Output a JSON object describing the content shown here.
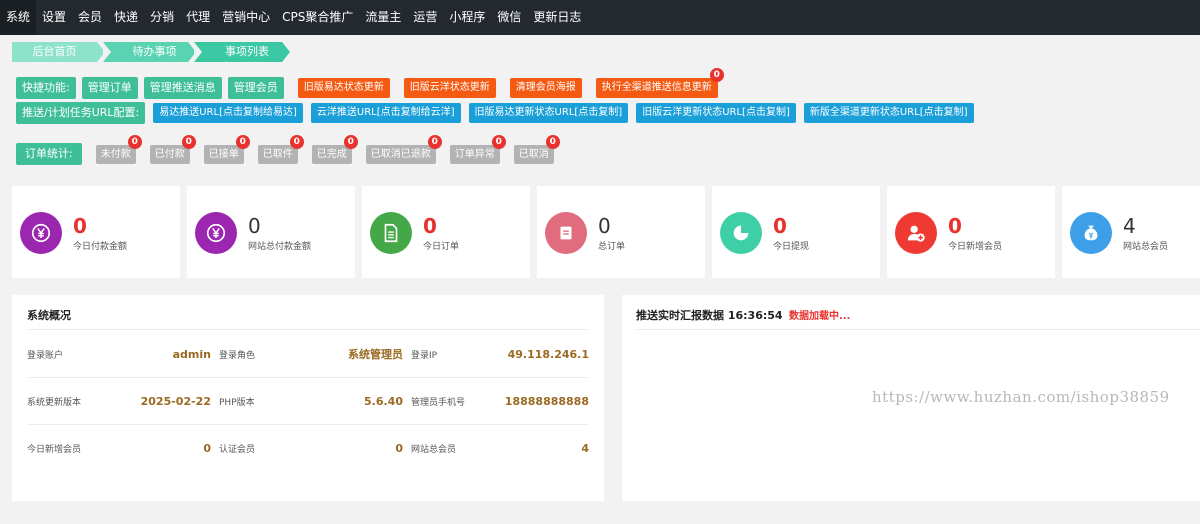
{
  "nav": {
    "items": [
      "系统",
      "设置",
      "会员",
      "快递",
      "分销",
      "代理",
      "营销中心",
      "CPS聚合推广",
      "流量主",
      "运营",
      "小程序",
      "微信",
      "更新日志"
    ]
  },
  "breadcrumb": [
    "后台首页",
    "待办事项",
    "事项列表"
  ],
  "quick": {
    "label": "快捷功能:",
    "green_buttons": [
      "管理订单",
      "管理推送消息",
      "管理会员"
    ],
    "orange_buttons": [
      "旧版易达状态更新",
      "旧版云洋状态更新",
      "清理会员海报",
      "执行全渠道推送信息更新"
    ],
    "orange_badge": "0"
  },
  "push": {
    "label": "推送/计划任务URL配置:",
    "buttons": [
      "易达推送URL[点击复制给易达]",
      "云洋推送URL[点击复制给云洋]",
      "旧版易达更新状态URL[点击复制]",
      "旧版云洋更新状态URL[点击复制]",
      "新版全渠道更新状态URL[点击复制]"
    ]
  },
  "orders": {
    "label": "订单统计:",
    "items": [
      {
        "label": "未付款",
        "count": "0"
      },
      {
        "label": "已付款",
        "count": "0"
      },
      {
        "label": "已接单",
        "count": "0"
      },
      {
        "label": "已取件",
        "count": "0"
      },
      {
        "label": "已完成",
        "count": "0"
      },
      {
        "label": "已取消已退款",
        "count": "0"
      },
      {
        "label": "订单异常",
        "count": "0"
      },
      {
        "label": "已取消",
        "count": "0"
      }
    ]
  },
  "stats": [
    {
      "value": "0",
      "caption": "今日付款金额",
      "color": "#9b27b0",
      "icon": "yen-icon",
      "highlight": true
    },
    {
      "value": "0",
      "caption": "网站总付款金额",
      "color": "#9b27b0",
      "icon": "yen-icon",
      "highlight": false
    },
    {
      "value": "0",
      "caption": "今日订单",
      "color": "#44a848",
      "icon": "document-icon",
      "highlight": true
    },
    {
      "value": "0",
      "caption": "总订单",
      "color": "#e06c7e",
      "icon": "list-icon",
      "highlight": false
    },
    {
      "value": "0",
      "caption": "今日提现",
      "color": "#3ecfa6",
      "icon": "pie-chart-icon",
      "highlight": true
    },
    {
      "value": "0",
      "caption": "今日新增会员",
      "color": "#ee3a32",
      "icon": "add-user-icon",
      "highlight": true
    },
    {
      "value": "4",
      "caption": "网站总会员",
      "color": "#3d9fe8",
      "icon": "money-bag-icon",
      "highlight": false
    }
  ],
  "overview": {
    "title": "系统概况",
    "rows": [
      [
        {
          "k": "登录账户",
          "v": "admin"
        },
        {
          "k": "登录角色",
          "v": "系统管理员"
        },
        {
          "k": "登录IP",
          "v": "49.118.246.1"
        }
      ],
      [
        {
          "k": "系统更新版本",
          "v": "2025-02-22"
        },
        {
          "k": "PHP版本",
          "v": "5.6.40"
        },
        {
          "k": "管理员手机号",
          "v": "18888888888"
        }
      ],
      [
        {
          "k": "今日新增会员",
          "v": "0"
        },
        {
          "k": "认证会员",
          "v": "0"
        },
        {
          "k": "网站总会员",
          "v": "4"
        }
      ]
    ]
  },
  "push_report": {
    "title": "推送实时汇报数据 16:36:54",
    "loading": "数据加载中...",
    "watermark": "https://www.huzhan.com/ishop38859"
  }
}
